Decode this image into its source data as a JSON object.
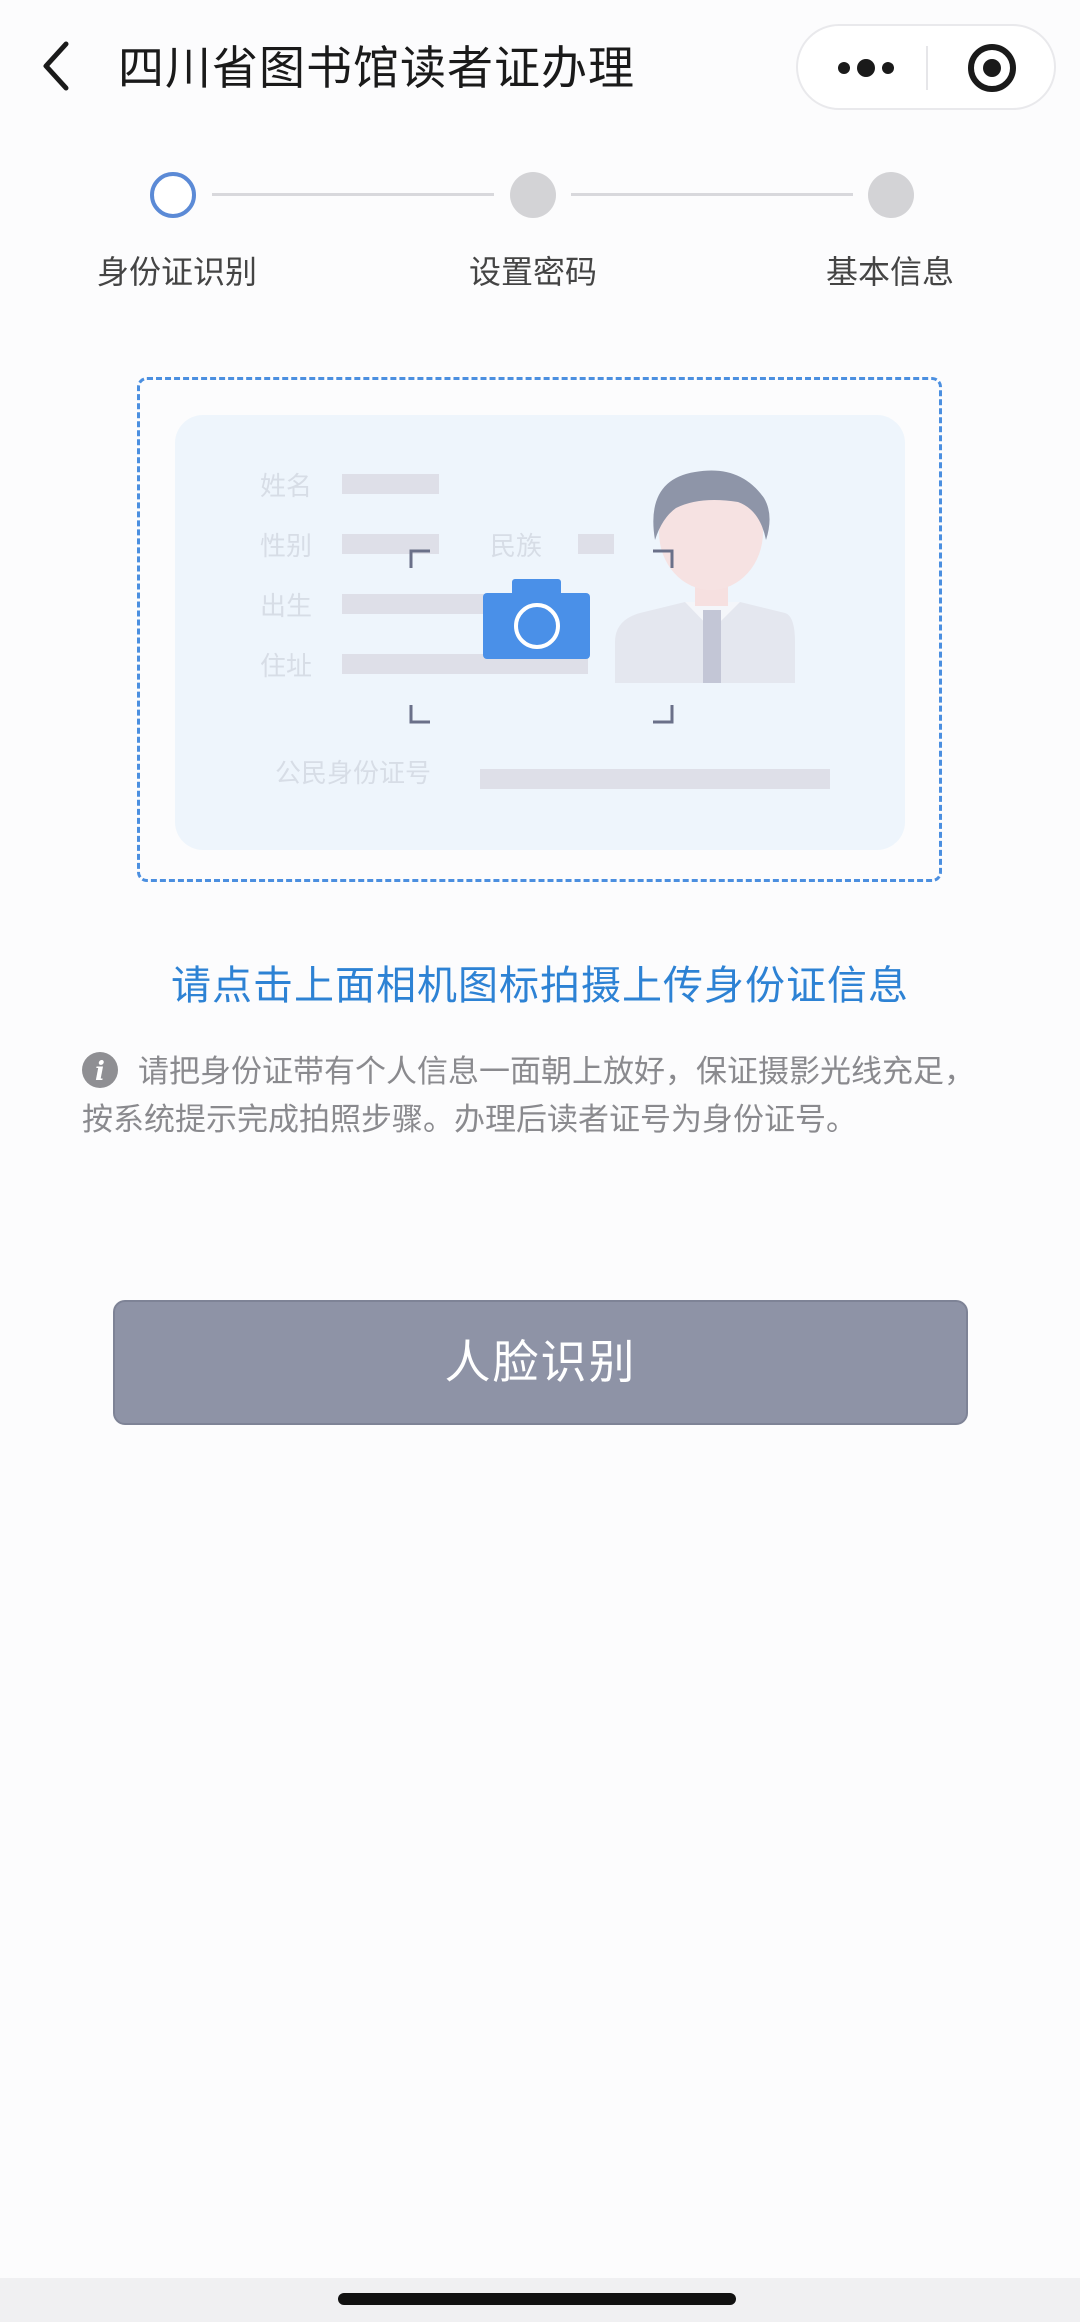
{
  "header": {
    "title": "四川省图书馆读者证办理",
    "back_icon": "chevron-left-icon",
    "more_icon": "more-dots-icon",
    "target_icon": "close-miniprogram-icon"
  },
  "steps": [
    {
      "label": "身份证识别",
      "state": "active"
    },
    {
      "label": "设置密码",
      "state": "inactive"
    },
    {
      "label": "基本信息",
      "state": "inactive"
    }
  ],
  "id_card": {
    "name_label": "姓名",
    "gender_label": "性别",
    "ethnicity_label": "民族",
    "birth_label": "出生",
    "address_label": "住址",
    "id_number_label": "公民身份证号",
    "camera_icon": "camera-icon"
  },
  "hint": {
    "instruction": "请点击上面相机图标拍摄上传身份证信息",
    "tip": "请把身份证带有个人信息一面朝上放好，保证摄影光线充足，按系统提示完成拍照步骤。办理后读者证号为身份证号。",
    "info_icon": "info-icon"
  },
  "button": {
    "face_recognition_label": "人脸识别"
  },
  "colors": {
    "accent_blue": "#2d82d4",
    "camera_blue": "#4a90e8",
    "button_gray": "#8e93a6"
  }
}
